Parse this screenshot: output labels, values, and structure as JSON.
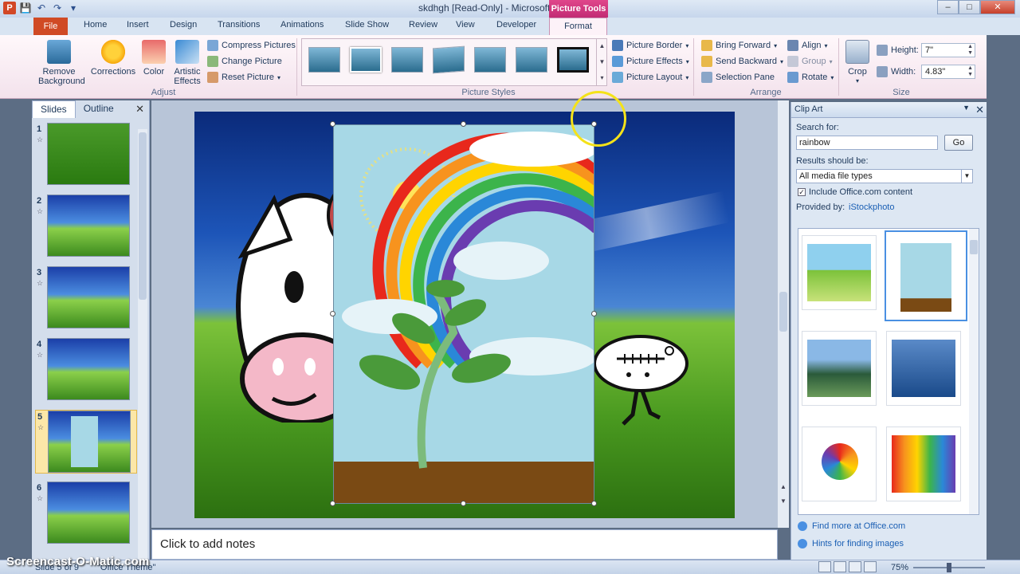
{
  "app": {
    "title": "skdhgh [Read-Only] - Microsoft PowerPoint",
    "context_group": "Picture Tools",
    "logo_letter": "P"
  },
  "tabs": {
    "file": "File",
    "items": [
      "Home",
      "Insert",
      "Design",
      "Transitions",
      "Animations",
      "Slide Show",
      "Review",
      "View",
      "Developer"
    ],
    "format": "Format"
  },
  "ribbon": {
    "adjust": {
      "label": "Adjust",
      "remove_background": "Remove Background",
      "corrections": "Corrections",
      "color": "Color",
      "artistic_effects": "Artistic Effects",
      "compress_pictures": "Compress Pictures",
      "change_picture": "Change Picture",
      "reset_picture": "Reset Picture"
    },
    "picture_styles": {
      "label": "Picture Styles",
      "picture_border": "Picture Border",
      "picture_effects": "Picture Effects",
      "picture_layout": "Picture Layout"
    },
    "arrange": {
      "label": "Arrange",
      "bring_forward": "Bring Forward",
      "send_backward": "Send Backward",
      "selection_pane": "Selection Pane",
      "align": "Align",
      "group": "Group",
      "rotate": "Rotate",
      "crop": "Crop"
    },
    "size": {
      "label": "Size",
      "height_label": "Height:",
      "height_value": "7\"",
      "width_label": "Width:",
      "width_value": "4.83\""
    }
  },
  "left_pane": {
    "tab_slides": "Slides",
    "tab_outline": "Outline",
    "slides": [
      "1",
      "2",
      "3",
      "4",
      "5",
      "6"
    ],
    "active_slide": "5"
  },
  "notes": {
    "placeholder": "Click to add notes"
  },
  "clip_art": {
    "title": "Clip Art",
    "search_label": "Search for:",
    "search_value": "rainbow",
    "go_label": "Go",
    "results_label": "Results should be:",
    "results_value": "All media file types",
    "include_office": "Include Office.com content",
    "provided_by_label": "Provided by:",
    "provider": "iStockphoto",
    "find_more": "Find more at Office.com",
    "hints": "Hints for finding images"
  },
  "status": {
    "zoom": "75%",
    "slide_info": "Slide 5 of 9",
    "theme": "\"Office Theme\""
  },
  "watermark": "Screencast-O-Matic.com",
  "colors": {
    "file_tab": "#d04a25",
    "context_tab": "#c22c74",
    "ribbon_bg": "#fff8fb",
    "selection": "#4a90e2"
  }
}
